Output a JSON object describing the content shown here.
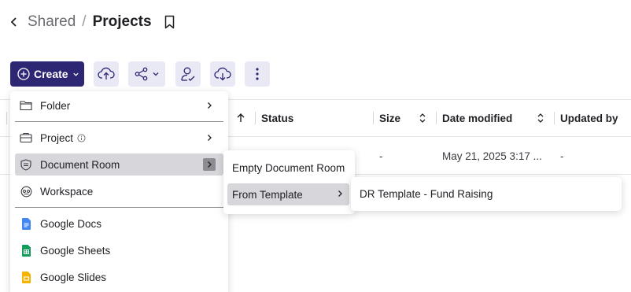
{
  "breadcrumb": {
    "parent": "Shared",
    "separator": "/",
    "current": "Projects"
  },
  "toolbar": {
    "create_label": "Create"
  },
  "table": {
    "columns": [
      "Status",
      "Size",
      "Date modified",
      "Updated by"
    ],
    "rows": [
      {
        "size": "-",
        "date_modified": "May 21, 2025 3:17 ...",
        "updated_by": "-"
      }
    ]
  },
  "create_menu": {
    "items": [
      {
        "label": "Folder"
      },
      {
        "label": "Project"
      },
      {
        "label": "Document Room"
      },
      {
        "label": "Workspace"
      },
      {
        "label": "Google Docs"
      },
      {
        "label": "Google Sheets"
      },
      {
        "label": "Google Slides"
      }
    ]
  },
  "document_room_menu": {
    "items": [
      {
        "label": "Empty Document Room"
      },
      {
        "label": "From Template"
      }
    ]
  },
  "template_menu": {
    "items": [
      {
        "label": "DR Template - Fund Raising"
      }
    ]
  },
  "colors": {
    "primary": "#2c2673",
    "toolbar_button_bg": "#e9e8f5",
    "hover": "#d6d6db",
    "google_docs": "#4285f4",
    "google_sheets": "#0f9d58",
    "google_slides": "#f4b400"
  }
}
